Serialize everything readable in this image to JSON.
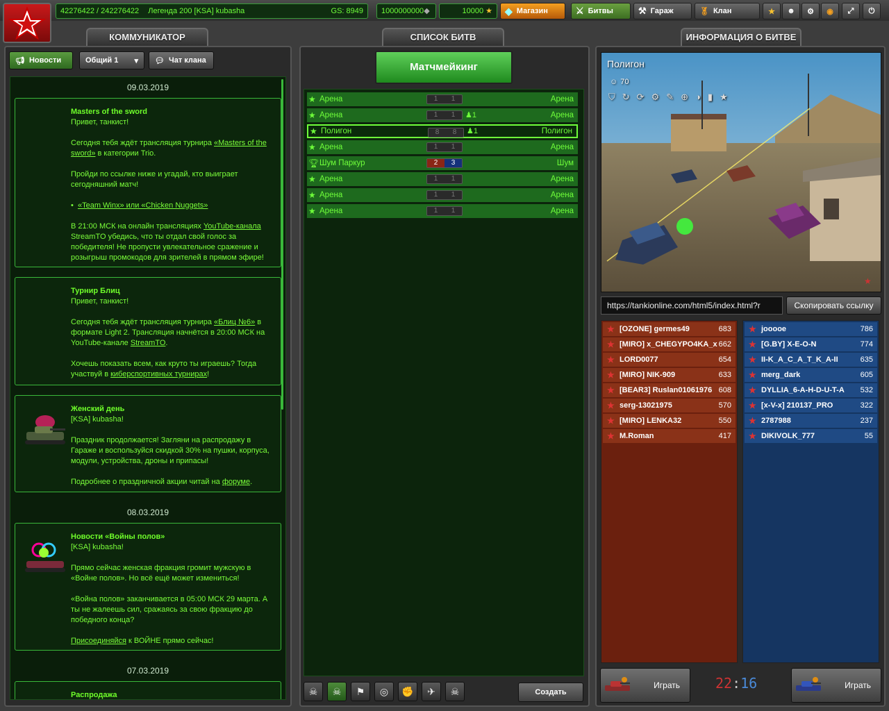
{
  "topbar": {
    "experience": "42276422 / 242276422",
    "rank_name": "Легенда 200 [KSA] kubasha",
    "gear_score": "GS: 8949",
    "crystals": "1000000000",
    "stars": "10000",
    "shop_label": "Магазин",
    "battles_label": "Битвы",
    "garage_label": "Гараж",
    "clan_label": "Клан"
  },
  "communicator": {
    "title": "КОММУНИКАТОР",
    "tab_news": "Новости",
    "channel_select": "Общий 1",
    "tab_clan_chat": "Чат клана",
    "dates": [
      "09.03.2019",
      "08.03.2019",
      "07.03.2019"
    ],
    "news": [
      {
        "title": "Masters of the sword",
        "greeting": "Привет, танкист!",
        "p1_a": "Сегодня тебя ждёт трансляция турнира ",
        "p1_link": "«Masters of the sword»",
        "p1_b": " в категории Trio.",
        "p2": "Пройди по ссылке ниже и угадай, кто выиграет сегодняшний матч!",
        "bullet": "«Team Winx» или «Chicken Nuggets»",
        "p3_a": "В 21:00 МСК на онлайн трансляциях ",
        "p3_link": "YouTube-канала",
        "p3_b": " StreamTO убедись, что ты отдал свой голос за победителя! Не пропусти увлекательное сражение и розыгрыш промокодов для зрителей в прямом эфире!"
      },
      {
        "title": "Турнир Блиц",
        "greeting": "Привет, танкист!",
        "p1_a": "Сегодня тебя ждёт трансляция турнира ",
        "p1_link": "«Блиц №6»",
        "p1_b": " в формате Light 2. Трансляция начнётся в 20:00 МСК на YouTube-канале ",
        "p1_link2": "StreamTO",
        "p1_c": ".",
        "p2_a": "Хочешь показать всем, как круто ты играешь? Тогда участвуй в ",
        "p2_link": "киберспортивных турнирах",
        "p2_b": "!"
      },
      {
        "title": "Женский день",
        "greeting": "[KSA] kubasha!",
        "p1": "Праздник продолжается! Загляни на распродажу в Гараже и воспользуйся скидкой 30% на пушки, корпуса, модули, устройства, дроны и припасы!",
        "p2_a": "Подробнее о праздничной акции читай на ",
        "p2_link": "форуме",
        "p2_b": "."
      },
      {
        "title": "Новости «Войны полов»",
        "greeting": "[KSA] kubasha!",
        "p1": "Прямо сейчас женская фракция громит мужскую в «Войне полов». Но всё ещё может измениться!",
        "p2": "«Война полов» заканчивается в 05:00 МСК 29 марта. А ты не жалеешь сил, сражаясь за свою фракцию до победного конца?",
        "p3_link": "Присоединяйся",
        "p3_b": " к ВОЙНЕ прямо сейчас!"
      }
    ],
    "partial_title": "Распродажа"
  },
  "battles": {
    "title": "СПИСОК БИТВ",
    "matchmaking_label": "Матчмейкинг",
    "create_label": "Создать",
    "rows": [
      {
        "name": "Арена",
        "map": "Арена",
        "a": "1",
        "b": "1",
        "players": "",
        "mode": "star",
        "dm": false
      },
      {
        "name": "Арена",
        "map": "Арена",
        "a": "1",
        "b": "1",
        "players": "1",
        "mode": "star",
        "dm": false
      },
      {
        "name": "Полигон",
        "map": "Полигон",
        "a": "8",
        "b": "8",
        "players": "1",
        "mode": "star",
        "dm": false
      },
      {
        "name": "Арена",
        "map": "Арена",
        "a": "1",
        "b": "1",
        "players": "",
        "mode": "star",
        "dm": false
      },
      {
        "name": "Шум Паркур",
        "map": "Шум",
        "a": "2",
        "b": "3",
        "players": "",
        "mode": "trophy",
        "dm": true
      },
      {
        "name": "Арена",
        "map": "Арена",
        "a": "1",
        "b": "1",
        "players": "",
        "mode": "star",
        "dm": false
      },
      {
        "name": "Арена",
        "map": "Арена",
        "a": "1",
        "b": "1",
        "players": "",
        "mode": "star",
        "dm": false
      },
      {
        "name": "Арена",
        "map": "Арена",
        "a": "1",
        "b": "1",
        "players": "",
        "mode": "star",
        "dm": false
      }
    ]
  },
  "info": {
    "title": "ИНФОРМАЦИЯ О БИТВЕ",
    "map_name": "Полигон",
    "player_limit": "70",
    "url": "https://tankionline.com/html5/index.html?r",
    "copy_label": "Скопировать ссылку",
    "play_red": "Играть",
    "play_blue": "Играть",
    "score_red": "22",
    "score_sep": ":",
    "score_blue": "16",
    "red_team": [
      {
        "name": "[OZONE] germes49",
        "score": "683"
      },
      {
        "name": "[MIRO] x_CHEGYPO4KA_x",
        "score": "662"
      },
      {
        "name": "LORD0077",
        "score": "654"
      },
      {
        "name": "[MIRO] NIK-909",
        "score": "633"
      },
      {
        "name": "[BEAR3] Ruslan01061976",
        "score": "608"
      },
      {
        "name": "serg-13021975",
        "score": "570"
      },
      {
        "name": "[MIRO] LENKA32",
        "score": "550"
      },
      {
        "name": "M.Roman",
        "score": "417"
      }
    ],
    "blue_team": [
      {
        "name": "jooooe",
        "score": "786"
      },
      {
        "name": "[G.BY] X-E-O-N",
        "score": "774"
      },
      {
        "name": "II-K_A_C_A_T_K_A-II",
        "score": "635"
      },
      {
        "name": "merg_dark",
        "score": "605"
      },
      {
        "name": "DYLLIA_6-A-H-D-U-T-A",
        "score": "532"
      },
      {
        "name": "[x-V-x] 210137_PRO",
        "score": "322"
      },
      {
        "name": "2787988",
        "score": "237"
      },
      {
        "name": "DIKIVOLK_777",
        "score": "55"
      }
    ]
  },
  "colors": {
    "accent_green": "#6fff3a",
    "red_team": "#8a3218",
    "blue_team": "#1f4a84"
  }
}
